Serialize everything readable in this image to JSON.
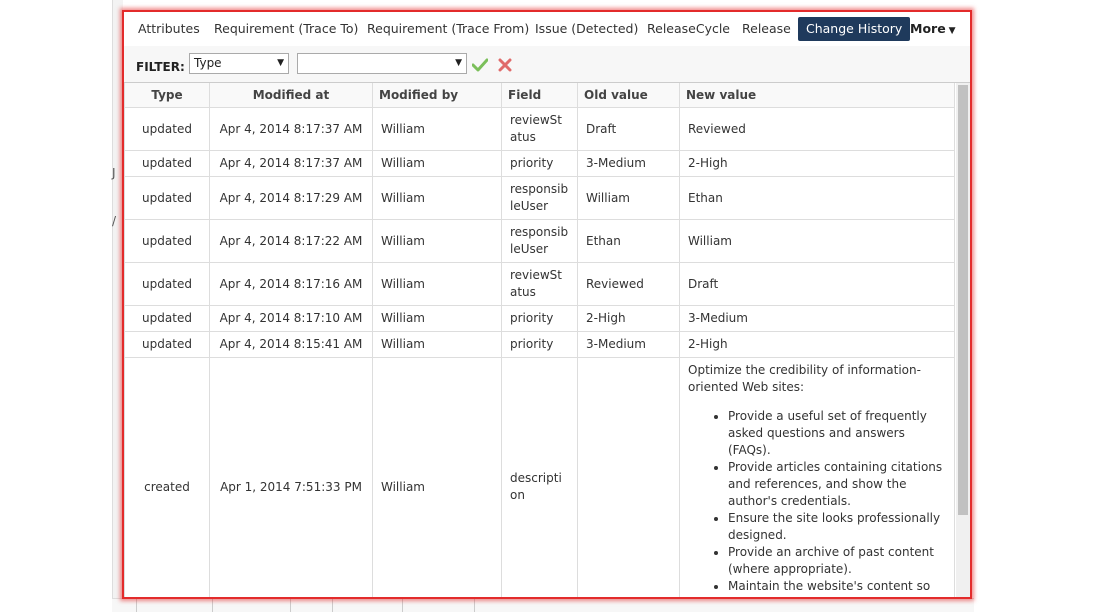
{
  "background": {
    "glyph_1": "J",
    "glyph_2": "/"
  },
  "tabs": [
    {
      "label": "Attributes",
      "active": false
    },
    {
      "label": "Requirement (Trace To)",
      "active": false
    },
    {
      "label": "Requirement (Trace From)",
      "active": false
    },
    {
      "label": "Issue (Detected)",
      "active": false
    },
    {
      "label": "ReleaseCycle",
      "active": false
    },
    {
      "label": "Release",
      "active": false
    },
    {
      "label": "Change History",
      "active": true
    },
    {
      "label": "More",
      "active": false
    }
  ],
  "filter": {
    "label": "FILTER:",
    "type_select_value": "Type",
    "value_select_value": "",
    "apply_icon": "checkmark-icon",
    "clear_icon": "x-icon"
  },
  "table": {
    "columns": [
      "Type",
      "Modified at",
      "Modified by",
      "Field",
      "Old value",
      "New value"
    ],
    "rows": [
      {
        "type": "updated",
        "modified_at": "Apr 4, 2014 8:17:37 AM",
        "modified_by": "William",
        "field": "reviewStatus",
        "old_value": "Draft",
        "new_value": "Reviewed"
      },
      {
        "type": "updated",
        "modified_at": "Apr 4, 2014 8:17:37 AM",
        "modified_by": "William",
        "field": "priority",
        "old_value": "3-Medium",
        "new_value": "2-High"
      },
      {
        "type": "updated",
        "modified_at": "Apr 4, 2014 8:17:29 AM",
        "modified_by": "William",
        "field": "responsibleUser",
        "old_value": "William",
        "new_value": "Ethan"
      },
      {
        "type": "updated",
        "modified_at": "Apr 4, 2014 8:17:22 AM",
        "modified_by": "William",
        "field": "responsibleUser",
        "old_value": "Ethan",
        "new_value": "William"
      },
      {
        "type": "updated",
        "modified_at": "Apr 4, 2014 8:17:16 AM",
        "modified_by": "William",
        "field": "reviewStatus",
        "old_value": "Reviewed",
        "new_value": "Draft"
      },
      {
        "type": "updated",
        "modified_at": "Apr 4, 2014 8:17:10 AM",
        "modified_by": "William",
        "field": "priority",
        "old_value": "2-High",
        "new_value": "3-Medium"
      },
      {
        "type": "updated",
        "modified_at": "Apr 4, 2014 8:15:41 AM",
        "modified_by": "William",
        "field": "priority",
        "old_value": "3-Medium",
        "new_value": "2-High"
      }
    ],
    "created_row": {
      "type": "created",
      "modified_at": "Apr 1, 2014 7:51:33 PM",
      "modified_by": "William",
      "field": "description",
      "old_value": "",
      "description_intro": "Optimize the credibility of information-oriented Web sites:",
      "description_items": [
        "Provide a useful set of frequently asked questions and answers (FAQs).",
        "Provide articles containing citations and references, and show the author's credentials.",
        "Ensure the site looks professionally designed.",
        "Provide an archive of past content (where appropriate).",
        "Maintain the website's content so that it is up to date."
      ]
    }
  }
}
